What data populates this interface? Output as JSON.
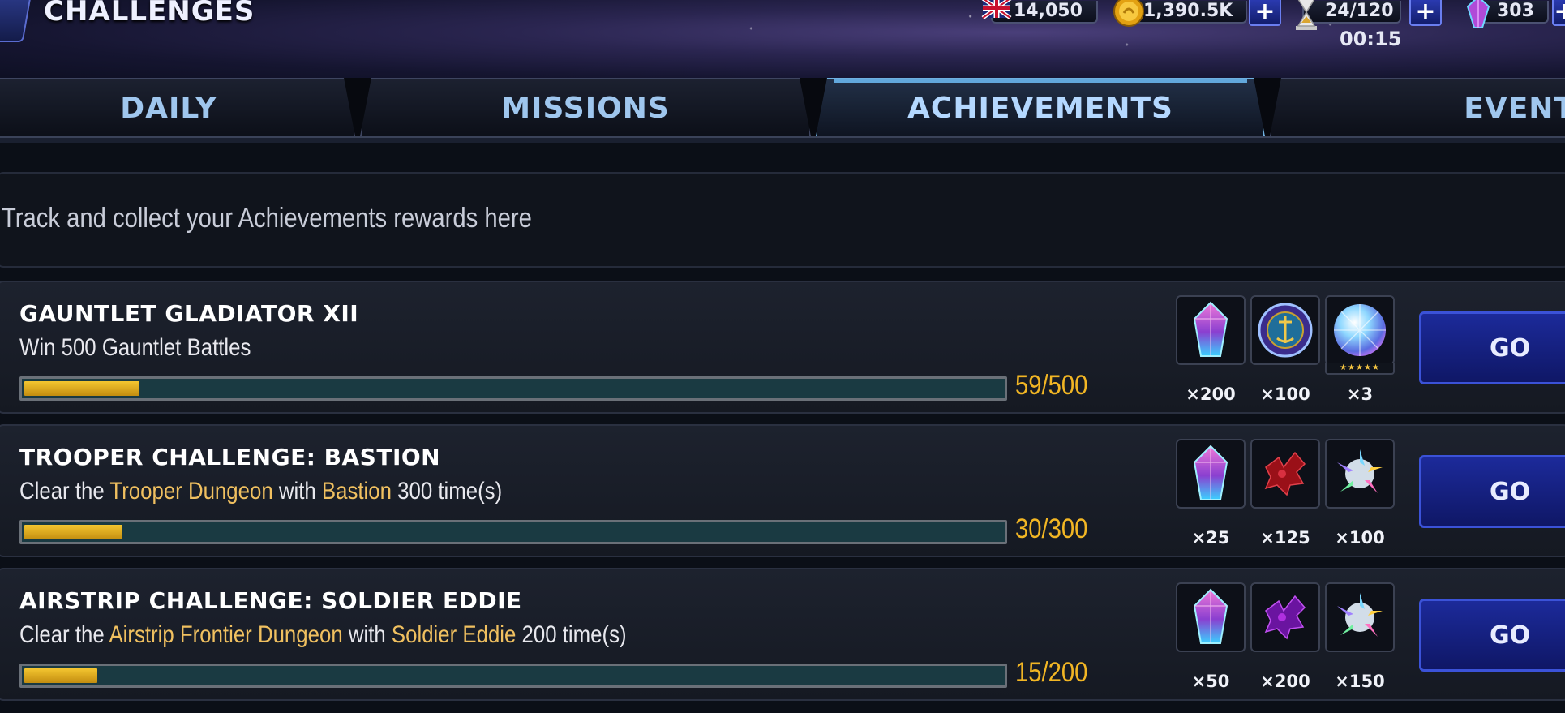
{
  "header": {
    "title": "CHALLENGES",
    "resources": {
      "flag_count": "14,050",
      "gold": "1,390.5K",
      "energy": "24/120",
      "energy_timer": "00:15",
      "crystals": "303"
    },
    "icons": [
      "back-icon",
      "uk-flag-icon",
      "gold-coin-icon",
      "hourglass-icon",
      "crystal-icon",
      "plus-icon"
    ]
  },
  "tabs": [
    {
      "label": "DAILY",
      "active": false
    },
    {
      "label": "MISSIONS",
      "active": false
    },
    {
      "label": "ACHIEVEMENTS",
      "active": true
    },
    {
      "label": "EVENT",
      "active": false
    }
  ],
  "description": "Track and collect your Achievements rewards here",
  "achievements": [
    {
      "title": "GAUNTLET GLADIATOR XII",
      "sub_plain": "Win 500 Gauntlet Battles",
      "progress_text": "59/500",
      "progress_fraction": 0.118,
      "rewards": [
        {
          "icon": "pink-crystal-icon",
          "qty": "×200"
        },
        {
          "icon": "gauntlet-medal-icon",
          "qty": "×100"
        },
        {
          "icon": "diamond-gem-icon",
          "qty": "×3",
          "stars": "★★★★★"
        }
      ],
      "go_label": "GO"
    },
    {
      "title": "TROOPER CHALLENGE: BASTION",
      "sub_parts": [
        "Clear the ",
        "Trooper Dungeon",
        " with ",
        "Bastion",
        " 300 time(s)"
      ],
      "progress_text": "30/300",
      "progress_fraction": 0.1,
      "rewards": [
        {
          "icon": "pink-crystal-icon",
          "qty": "×25"
        },
        {
          "icon": "red-shard-icon",
          "qty": "×125"
        },
        {
          "icon": "prism-shards-icon",
          "qty": "×100"
        }
      ],
      "go_label": "GO"
    },
    {
      "title": "AIRSTRIP CHALLENGE: SOLDIER EDDIE",
      "sub_parts": [
        "Clear the ",
        "Airstrip Frontier Dungeon",
        " with ",
        "Soldier Eddie",
        " 200 time(s)"
      ],
      "progress_text": "15/200",
      "progress_fraction": 0.075,
      "rewards": [
        {
          "icon": "pink-crystal-icon",
          "qty": "×50"
        },
        {
          "icon": "purple-shard-icon",
          "qty": "×200"
        },
        {
          "icon": "prism-shards-icon",
          "qty": "×150"
        }
      ],
      "go_label": "GO"
    }
  ],
  "colors": {
    "accent_gold": "#f2b624",
    "highlight": "#f0c060",
    "tab_text": "#9fc6ee",
    "go_button": "#1c2a9a"
  }
}
